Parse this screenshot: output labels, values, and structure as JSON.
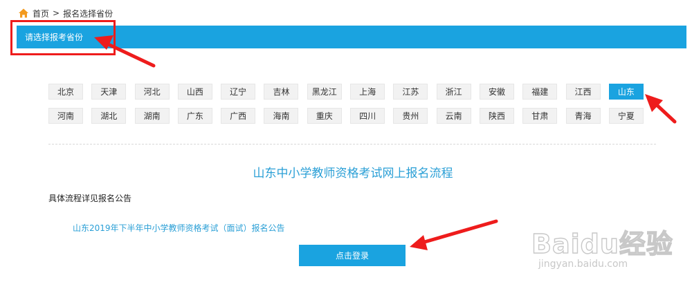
{
  "breadcrumb": {
    "home": "首页",
    "separator": ">",
    "current": "报名选择省份"
  },
  "banner": {
    "title": "请选择报考省份"
  },
  "provinces_row1": [
    {
      "label": "北京"
    },
    {
      "label": "天津"
    },
    {
      "label": "河北"
    },
    {
      "label": "山西"
    },
    {
      "label": "辽宁"
    },
    {
      "label": "吉林"
    },
    {
      "label": "黑龙江"
    },
    {
      "label": "上海"
    },
    {
      "label": "江苏"
    },
    {
      "label": "浙江"
    },
    {
      "label": "安徽"
    },
    {
      "label": "福建"
    },
    {
      "label": "江西"
    },
    {
      "label": "山东",
      "selected": true
    }
  ],
  "provinces_row2": [
    {
      "label": "河南"
    },
    {
      "label": "湖北"
    },
    {
      "label": "湖南"
    },
    {
      "label": "广东"
    },
    {
      "label": "广西"
    },
    {
      "label": "海南"
    },
    {
      "label": "重庆"
    },
    {
      "label": "四川"
    },
    {
      "label": "贵州"
    },
    {
      "label": "云南"
    },
    {
      "label": "陕西"
    },
    {
      "label": "甘肃"
    },
    {
      "label": "青海"
    },
    {
      "label": "宁夏"
    }
  ],
  "process": {
    "title": "山东中小学教师资格考试网上报名流程",
    "detail": "具体流程详见报名公告",
    "notice_link": "山东2019年下半年中小学教师资格考试（面试）报名公告"
  },
  "login_button": "点击登录",
  "watermark": {
    "brand": "Baidu经验",
    "url": "jingyan.baidu.com"
  },
  "colors": {
    "accent": "#1aa3e0",
    "link": "#2a9fd6",
    "annotation": "#ee1c1c"
  },
  "icons": {
    "home": "home-icon"
  }
}
